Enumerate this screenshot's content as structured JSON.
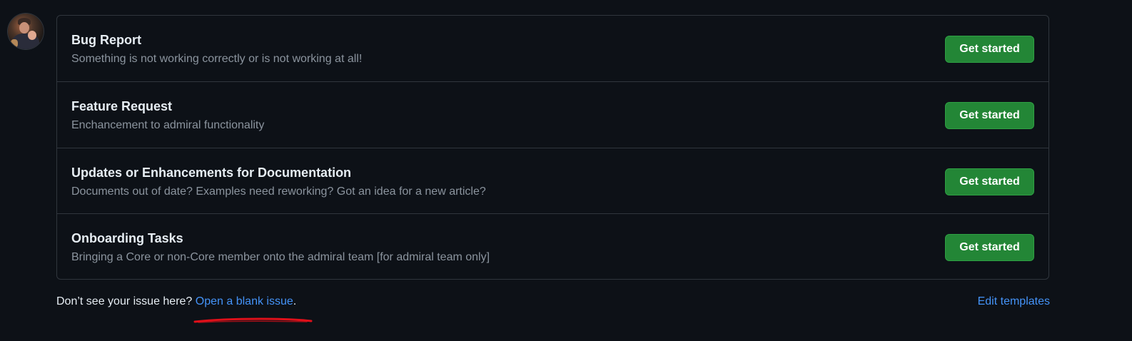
{
  "avatar": {
    "label": "user avatar"
  },
  "templates": [
    {
      "title": "Bug Report",
      "description": "Something is not working correctly or is not working at all!",
      "button": "Get started"
    },
    {
      "title": "Feature Request",
      "description": "Enchancement to admiral functionality",
      "button": "Get started"
    },
    {
      "title": "Updates or Enhancements for Documentation",
      "description": "Documents out of date? Examples need reworking? Got an idea for a new article?",
      "button": "Get started"
    },
    {
      "title": "Onboarding Tasks",
      "description": "Bringing a Core or non-Core member onto the admiral team [for admiral team only]",
      "button": "Get started"
    }
  ],
  "footer": {
    "prompt": "Don’t see your issue here?",
    "blank_issue_link": "Open a blank issue",
    "period": ".",
    "edit_templates": "Edit templates"
  },
  "colors": {
    "background": "#0d1117",
    "border": "#30363d",
    "button_green": "#238636",
    "link_blue": "#4493f8",
    "annotation_red": "#e0101a"
  }
}
